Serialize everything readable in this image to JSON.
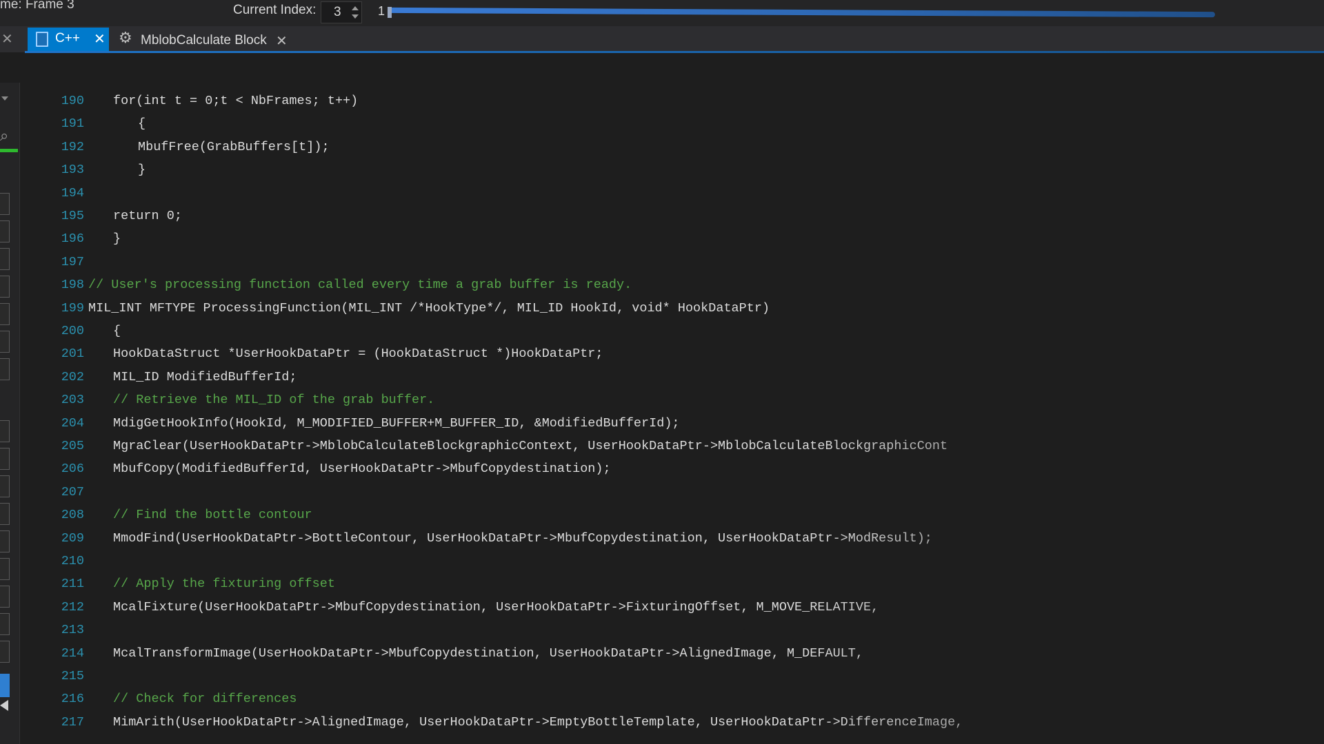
{
  "toolbar": {
    "frame_label": "me: Frame 3",
    "current_index_label": "Current Index:",
    "current_index_value": "3",
    "slider_value": "1"
  },
  "tabs": [
    {
      "label": "C++",
      "icon": "file-icon",
      "active": true
    },
    {
      "label": "MblobCalculate Block",
      "icon": "gear-icon",
      "active": false
    }
  ],
  "colors": {
    "accent": "#007acc",
    "line_number": "#2b91af",
    "comment": "#57a64a",
    "code_text": "#dcdcdc",
    "background": "#1e1e1e"
  },
  "code_lines": [
    {
      "num": "190",
      "text": "for(int t = 0;t < NbFrames; t++)",
      "type": "code"
    },
    {
      "num": "191",
      "text": "{",
      "type": "code"
    },
    {
      "num": "192",
      "text": "MbufFree(GrabBuffers[t]);",
      "type": "code"
    },
    {
      "num": "193",
      "text": "}",
      "type": "code"
    },
    {
      "num": "194",
      "text": "",
      "type": "code"
    },
    {
      "num": "195",
      "text": "return 0;",
      "type": "code"
    },
    {
      "num": "196",
      "text": "}",
      "type": "code"
    },
    {
      "num": "197",
      "text": "",
      "type": "code"
    },
    {
      "num": "198",
      "text": "// User's processing function called every time a grab buffer is ready.",
      "type": "comment"
    },
    {
      "num": "199",
      "text": "MIL_INT MFTYPE ProcessingFunction(MIL_INT /*HookType*/, MIL_ID HookId, void* HookDataPtr)",
      "type": "code"
    },
    {
      "num": "200",
      "text": "{",
      "type": "code"
    },
    {
      "num": "201",
      "text": "HookDataStruct *UserHookDataPtr = (HookDataStruct *)HookDataPtr;",
      "type": "code"
    },
    {
      "num": "202",
      "text": "MIL_ID ModifiedBufferId;",
      "type": "code"
    },
    {
      "num": "203",
      "text": "// Retrieve the MIL_ID of the grab buffer.",
      "type": "comment"
    },
    {
      "num": "204",
      "text": "MdigGetHookInfo(HookId, M_MODIFIED_BUFFER+M_BUFFER_ID, &ModifiedBufferId);",
      "type": "code"
    },
    {
      "num": "205",
      "text": "MgraClear(UserHookDataPtr->MblobCalculateBlockgraphicContext, UserHookDataPtr->MblobCalculateBlockgraphicCont",
      "type": "code"
    },
    {
      "num": "206",
      "text": "MbufCopy(ModifiedBufferId, UserHookDataPtr->MbufCopydestination);",
      "type": "code"
    },
    {
      "num": "207",
      "text": "",
      "type": "code"
    },
    {
      "num": "208",
      "text": "// Find the bottle contour",
      "type": "comment"
    },
    {
      "num": "209",
      "text": "MmodFind(UserHookDataPtr->BottleContour, UserHookDataPtr->MbufCopydestination, UserHookDataPtr->ModResult);",
      "type": "code"
    },
    {
      "num": "210",
      "text": "",
      "type": "code"
    },
    {
      "num": "211",
      "text": "// Apply the fixturing offset",
      "type": "comment"
    },
    {
      "num": "212",
      "text": "McalFixture(UserHookDataPtr->MbufCopydestination, UserHookDataPtr->FixturingOffset, M_MOVE_RELATIVE,",
      "type": "code"
    },
    {
      "num": "213",
      "text": "",
      "type": "code"
    },
    {
      "num": "214",
      "text": "McalTransformImage(UserHookDataPtr->MbufCopydestination, UserHookDataPtr->AlignedImage, M_DEFAULT,",
      "type": "code"
    },
    {
      "num": "215",
      "text": "",
      "type": "code"
    },
    {
      "num": "216",
      "text": "// Check for differences",
      "type": "comment"
    },
    {
      "num": "217",
      "text": "MimArith(UserHookDataPtr->AlignedImage, UserHookDataPtr->EmptyBottleTemplate, UserHookDataPtr->DifferenceImage,",
      "type": "code"
    }
  ]
}
